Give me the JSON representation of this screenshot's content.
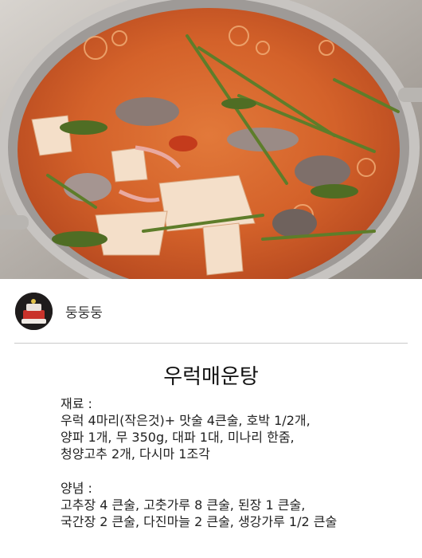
{
  "author": {
    "name": "둥둥둥"
  },
  "recipe": {
    "title": "우럭매운탕",
    "ingredients": {
      "label": "재료 :",
      "lines": [
        "우럭 4마리(작은것)+ 맛술 4큰술, 호박 1/2개,",
        "양파 1개, 무 350g, 대파 1대, 미나리 한줌,",
        "청양고추 2개, 다시마 1조각"
      ]
    },
    "seasoning": {
      "label": "양념 :",
      "lines": [
        "고추장 4 큰술, 고춧가루 8 큰술, 된장 1 큰술,",
        "국간장 2 큰술, 다진마늘 2 큰술, 생강가루 1/2 큰술"
      ]
    }
  },
  "colors": {
    "broth": "#d9682a",
    "pot": "#b9b6b3",
    "text": "#222222"
  }
}
